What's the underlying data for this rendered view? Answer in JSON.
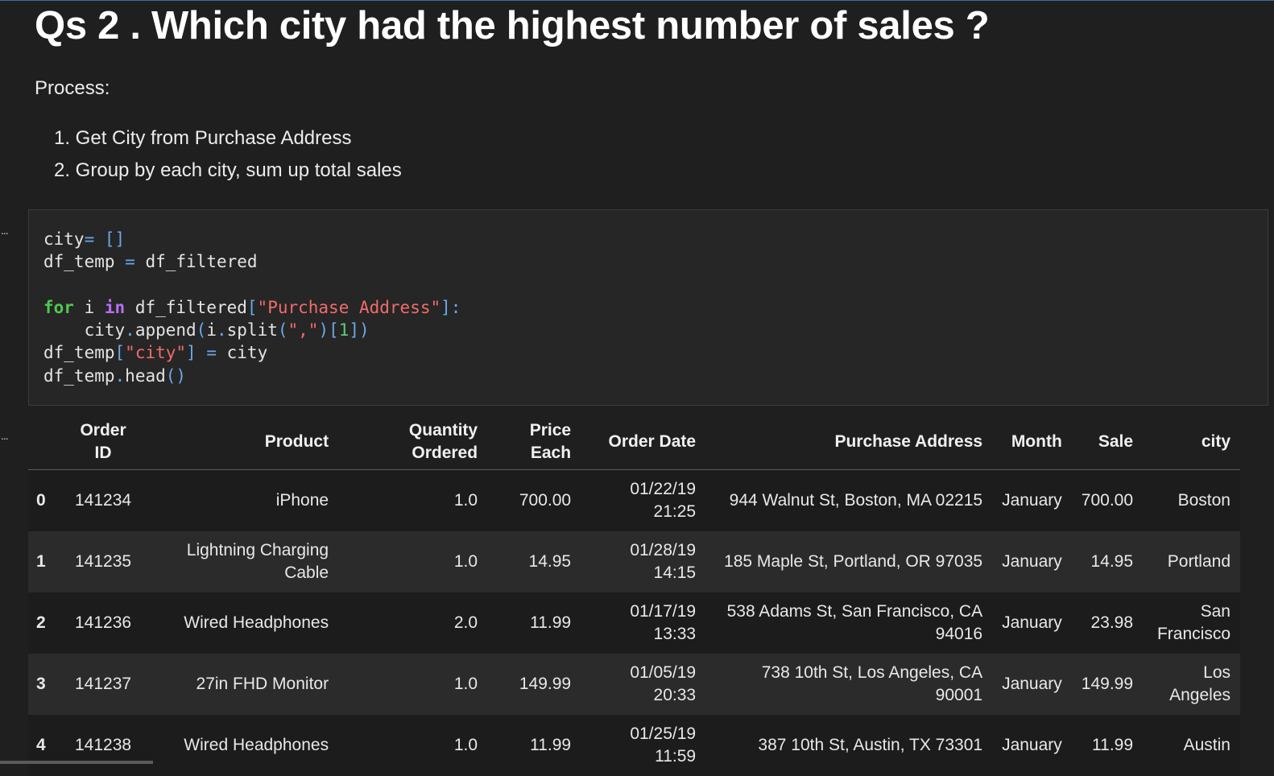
{
  "markdown": {
    "heading": "Qs 2 . Which city had the highest number of sales ?",
    "process_label": "Process:",
    "steps": [
      "1. Get City from Purchase Address",
      "2. Group by each city, sum up total sales"
    ]
  },
  "cell_marker": "...",
  "code_lines": [
    "city= []",
    "df_temp = df_filtered",
    "",
    "for i in df_filtered[\"Purchase Address\"]:",
    "    city.append(i.split(\",\")[1])",
    "df_temp[\"city\"] = city",
    "df_temp.head()"
  ],
  "table": {
    "columns": [
      "",
      "Order ID",
      "Product",
      "Quantity Ordered",
      "Price Each",
      "Order Date",
      "Purchase Address",
      "Month",
      "Sale",
      "city"
    ],
    "rows": [
      [
        "0",
        "141234",
        "iPhone",
        "1.0",
        "700.00",
        "01/22/19 21:25",
        "944 Walnut St, Boston, MA 02215",
        "January",
        "700.00",
        "Boston"
      ],
      [
        "1",
        "141235",
        "Lightning Charging Cable",
        "1.0",
        "14.95",
        "01/28/19 14:15",
        "185 Maple St, Portland, OR 97035",
        "January",
        "14.95",
        "Portland"
      ],
      [
        "2",
        "141236",
        "Wired Headphones",
        "2.0",
        "11.99",
        "01/17/19 13:33",
        "538 Adams St, San Francisco, CA 94016",
        "January",
        "23.98",
        "San Francisco"
      ],
      [
        "3",
        "141237",
        "27in FHD Monitor",
        "1.0",
        "149.99",
        "01/05/19 20:33",
        "738 10th St, Los Angeles, CA 90001",
        "January",
        "149.99",
        "Los Angeles"
      ],
      [
        "4",
        "141238",
        "Wired Headphones",
        "1.0",
        "11.99",
        "01/25/19 11:59",
        "387 10th St, Austin, TX 73301",
        "January",
        "11.99",
        "Austin"
      ]
    ]
  }
}
